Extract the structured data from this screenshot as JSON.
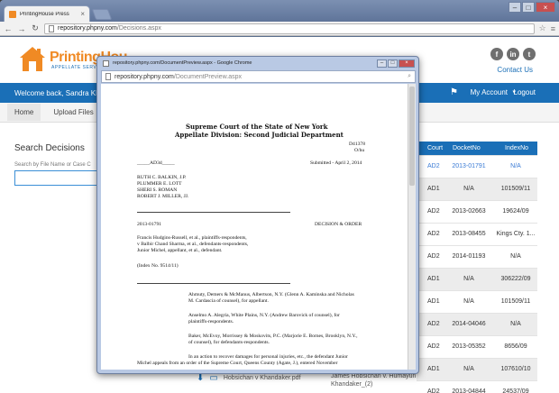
{
  "browser": {
    "tab_title": "PrintingHouse Press",
    "url_host": "repository.phpny.com",
    "url_path": "/Decisions.aspx"
  },
  "site": {
    "logo_text": "PrintingHou",
    "logo_sub": "APPELLATE SERVICES",
    "contact": "Contact Us",
    "welcome": "Welcome back, Sandra Khal",
    "my_account": "My Account",
    "logout": "Logout",
    "nav": [
      "Home",
      "Upload Files"
    ],
    "search_title": "Search Decisions",
    "search_label": "Search by File Name or Case C",
    "brand_color": "#1a6fb7",
    "accent_color": "#f08a24"
  },
  "results": {
    "headers": [
      "Court",
      "DocketNo",
      "IndexNo"
    ],
    "rows": [
      {
        "court": "AD2",
        "docket": "2013-01791",
        "index": "N/A",
        "style": "link"
      },
      {
        "court": "AD1",
        "docket": "N/A",
        "index": "101509/11",
        "style": "sel"
      },
      {
        "court": "AD2",
        "docket": "2013-02663",
        "index": "19624/09",
        "style": ""
      },
      {
        "court": "AD2",
        "docket": "2013-08455",
        "index": "Kings Cty. 1...",
        "style": ""
      },
      {
        "court": "AD2",
        "docket": "2014-01193",
        "index": "N/A",
        "style": ""
      },
      {
        "court": "AD1",
        "docket": "N/A",
        "index": "306222/09",
        "style": "sel"
      },
      {
        "court": "AD1",
        "docket": "N/A",
        "index": "101509/11",
        "style": ""
      },
      {
        "court": "AD2",
        "docket": "2014-04046",
        "index": "N/A",
        "style": "sel"
      },
      {
        "court": "AD2",
        "docket": "2013-05352",
        "index": "8656/09",
        "style": ""
      },
      {
        "court": "AD1",
        "docket": "N/A",
        "index": "107610/10",
        "style": "sel"
      },
      {
        "court": "AD2",
        "docket": "2013-04844",
        "index": "24537/09",
        "style": ""
      }
    ]
  },
  "downloads": {
    "file1": "Hobsichan v Khandaker.pdf",
    "file2a": "James Hobsichan v. Humayun",
    "file2b": "Khandaker_(2)"
  },
  "popup": {
    "title": "repository.phpny.com/DocumentPreview.aspx - Google Chrome",
    "url_host": "repository.phpny.com",
    "url_path": "/DocumentPreview.aspx",
    "doc": {
      "court1": "Supreme Court of the State of New York",
      "court2": "Appellate Division: Second Judicial Department",
      "docnum": "D41378",
      "docsub": "O/hu",
      "adm": "_____AD3d_____",
      "submitted": "Submitted - April 2, 2014",
      "judges": [
        "RUTH C. BALKIN, J.P.",
        "PLUMMER E. LOTT",
        "SHERI S. ROMAN",
        "ROBERT J. MILLER, JJ."
      ],
      "docket": "2013-01791",
      "decision": "DECISION & ORDER",
      "parties": [
        "Francis Hudgins-Russell, et al., plaintiffs-respondents,",
        "v Balbir Chand Sharma, et al., defendants-respondents,",
        "Junior Michel, appellant, et al., defendant."
      ],
      "index": "(Index No. 9514/11)",
      "counsel": [
        [
          "Ahmuty, Demers & McManus, Albertson, N.Y. (Glenn A. Kaminska and Nicholas",
          "M. Cardascia of counsel), for appellant."
        ],
        [
          "Anselmo A. Alegria, White Plains, N.Y. (Andrew Barovick of counsel), for",
          "plaintiffs-respondents."
        ],
        [
          "Baker, McEvoy, Morrissey & Moskovits, P.C. (Marjorie E. Bornes, Brooklyn, N.Y.,",
          "of counsel), for defendants-respondents."
        ]
      ],
      "body1": "In an action to recover damages for personal injuries, etc., the defendant Junior",
      "body2": "Michel appeals from an order of the Supreme Court, Queens County (Agate, J.), entered November"
    }
  }
}
